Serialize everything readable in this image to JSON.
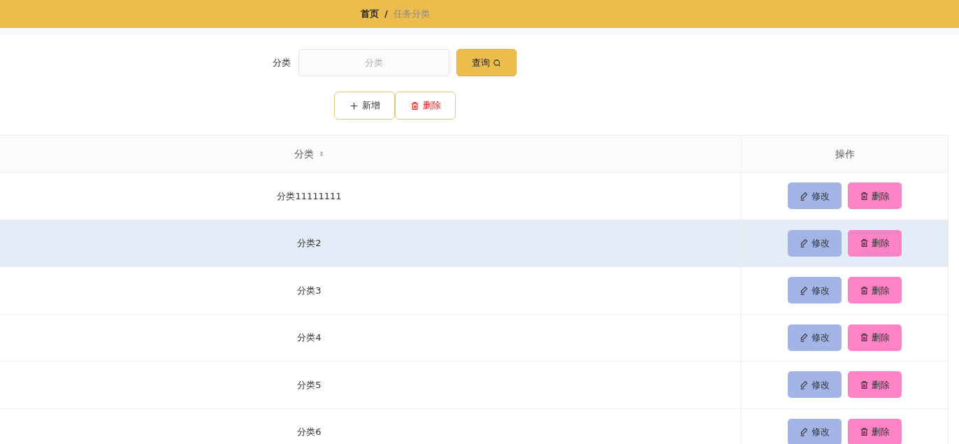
{
  "breadcrumb": [
    {
      "label": "首页",
      "current": false
    },
    {
      "label": "任务分类",
      "current": true
    }
  ],
  "breadcrumb_separator": "/",
  "filter": {
    "label": "分类",
    "placeholder": "分类",
    "button": "查询"
  },
  "actions": [
    {
      "kind": "add",
      "label": "新增"
    },
    {
      "kind": "delete",
      "label": "删除"
    }
  ],
  "table": {
    "columns": [
      {
        "label": "分类",
        "sortable": true
      },
      {
        "label": "操作",
        "sortable": false
      }
    ],
    "rows": [
      {
        "category": "分类11111111",
        "hovered": false,
        "edit": "修改",
        "delete": "删除"
      },
      {
        "category": "分类2",
        "hovered": true,
        "edit": "修改",
        "delete": "删除"
      },
      {
        "category": "分类3",
        "hovered": false,
        "edit": "修改",
        "delete": "删除"
      },
      {
        "category": "分类4",
        "hovered": false,
        "edit": "修改",
        "delete": "删除"
      },
      {
        "category": "分类5",
        "hovered": false,
        "edit": "修改",
        "delete": "删除"
      },
      {
        "category": "分类6",
        "hovered": false,
        "edit": "修改",
        "delete": "删除"
      }
    ]
  }
}
